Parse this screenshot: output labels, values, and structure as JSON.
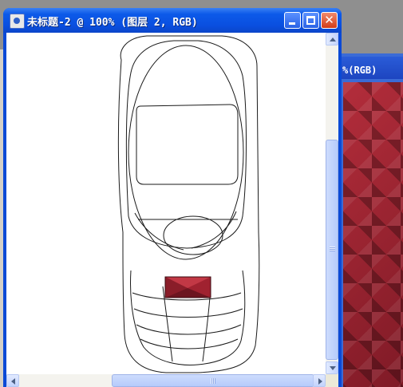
{
  "window": {
    "title": "未标题-2 @ 100% (图层 2, RGB)",
    "buttons": {
      "minimize": "minimize",
      "maximize": "maximize",
      "close": "✕"
    }
  },
  "background_window": {
    "title_fragment": "%(RGB)"
  },
  "colors": {
    "titlebar": "#0a4fe0",
    "key_fill": "#a02230",
    "pattern": "#8a1f2a"
  },
  "icons": {
    "app_icon": "photoshop-doc-icon",
    "scroll_up": "arrow-up-icon",
    "scroll_down": "arrow-down-icon",
    "scroll_left": "arrow-left-icon",
    "scroll_right": "arrow-right-icon"
  }
}
